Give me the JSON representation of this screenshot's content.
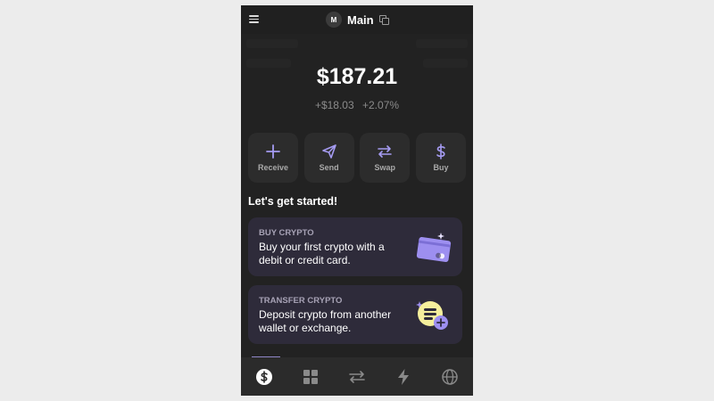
{
  "header": {
    "avatar_initial": "M",
    "account_name": "Main",
    "icons": [
      "menu-icon",
      "copy-icon"
    ]
  },
  "balance": {
    "amount": "$187.21",
    "change_amount": "+$18.03",
    "change_percent": "+2.07%"
  },
  "actions": [
    {
      "label": "Receive",
      "icon": "plus-icon"
    },
    {
      "label": "Send",
      "icon": "send-icon"
    },
    {
      "label": "Swap",
      "icon": "swap-icon"
    },
    {
      "label": "Buy",
      "icon": "dollar-icon"
    }
  ],
  "section_title": "Let's get started!",
  "cards": [
    {
      "kicker": "BUY CRYPTO",
      "text": "Buy your first crypto with a debit or credit card.",
      "icon": "credit-card-icon"
    },
    {
      "kicker": "TRANSFER CRYPTO",
      "text": "Deposit crypto from another wallet or exchange.",
      "icon": "deposit-coin-icon"
    }
  ],
  "bottom_nav": [
    {
      "icon": "dollar-circle-icon",
      "active": true
    },
    {
      "icon": "grid-icon",
      "active": false
    },
    {
      "icon": "transfer-icon",
      "active": false
    },
    {
      "icon": "lightning-icon",
      "active": false
    },
    {
      "icon": "globe-icon",
      "active": false
    }
  ],
  "colors": {
    "accent": "#a59bf2",
    "background": "#222222",
    "card": "#2e2b3a"
  }
}
